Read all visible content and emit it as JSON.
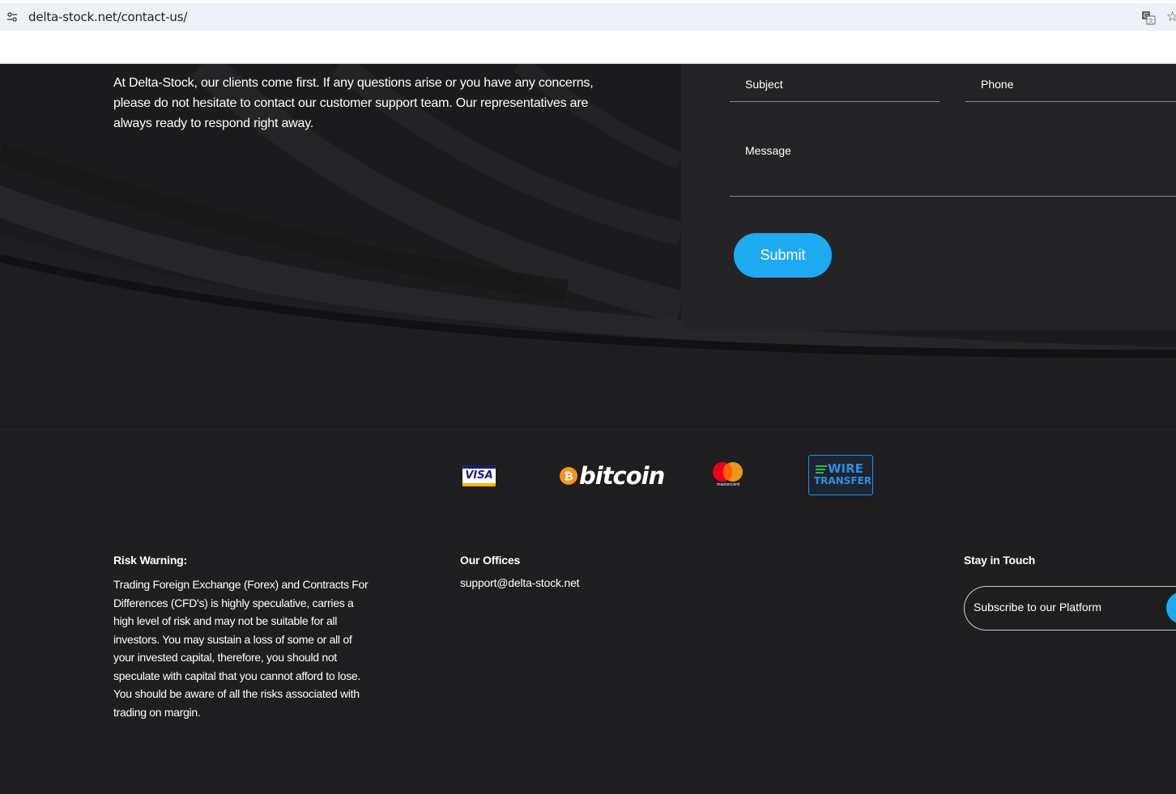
{
  "browser": {
    "url": "delta-stock.net/contact-us/",
    "icons": [
      "site-settings-icon",
      "translate-icon",
      "bookmark-star-icon"
    ]
  },
  "intro": {
    "text": "At Delta-Stock, our clients come first. If any questions arise or you have any concerns, please do not hesitate to contact our customer support team. Our representatives are always ready to respond right away."
  },
  "form": {
    "subject_label": "Subject",
    "phone_label": "Phone",
    "message_label": "Message",
    "submit_label": "Submit"
  },
  "payments": {
    "visa": "VISA",
    "bitcoin": "bitcoin",
    "bitcoin_symbol": "₿",
    "mastercard": "mastercard",
    "wire_line1": "WIRE",
    "wire_line2": "TRANSFER"
  },
  "footer": {
    "risk_title": "Risk Warning:",
    "risk_text": "Trading Foreign Exchange (Forex) and Contracts For Differences (CFD's) is highly speculative, carries a high level of risk and may not be suitable for all investors. You may sustain a loss of some or all of your invested capital, therefore, you should not speculate with capital that you cannot afford to lose. You should be aware of all the risks associated with trading on margin.",
    "offices_title": "Our Offices",
    "offices_email": "support@delta-stock.net",
    "touch_title": "Stay in Touch",
    "subscribe_placeholder": "Subscribe to our Platform"
  },
  "colors": {
    "accent": "#1eaaf1",
    "background": "#1e1e21",
    "card": "#232326"
  }
}
